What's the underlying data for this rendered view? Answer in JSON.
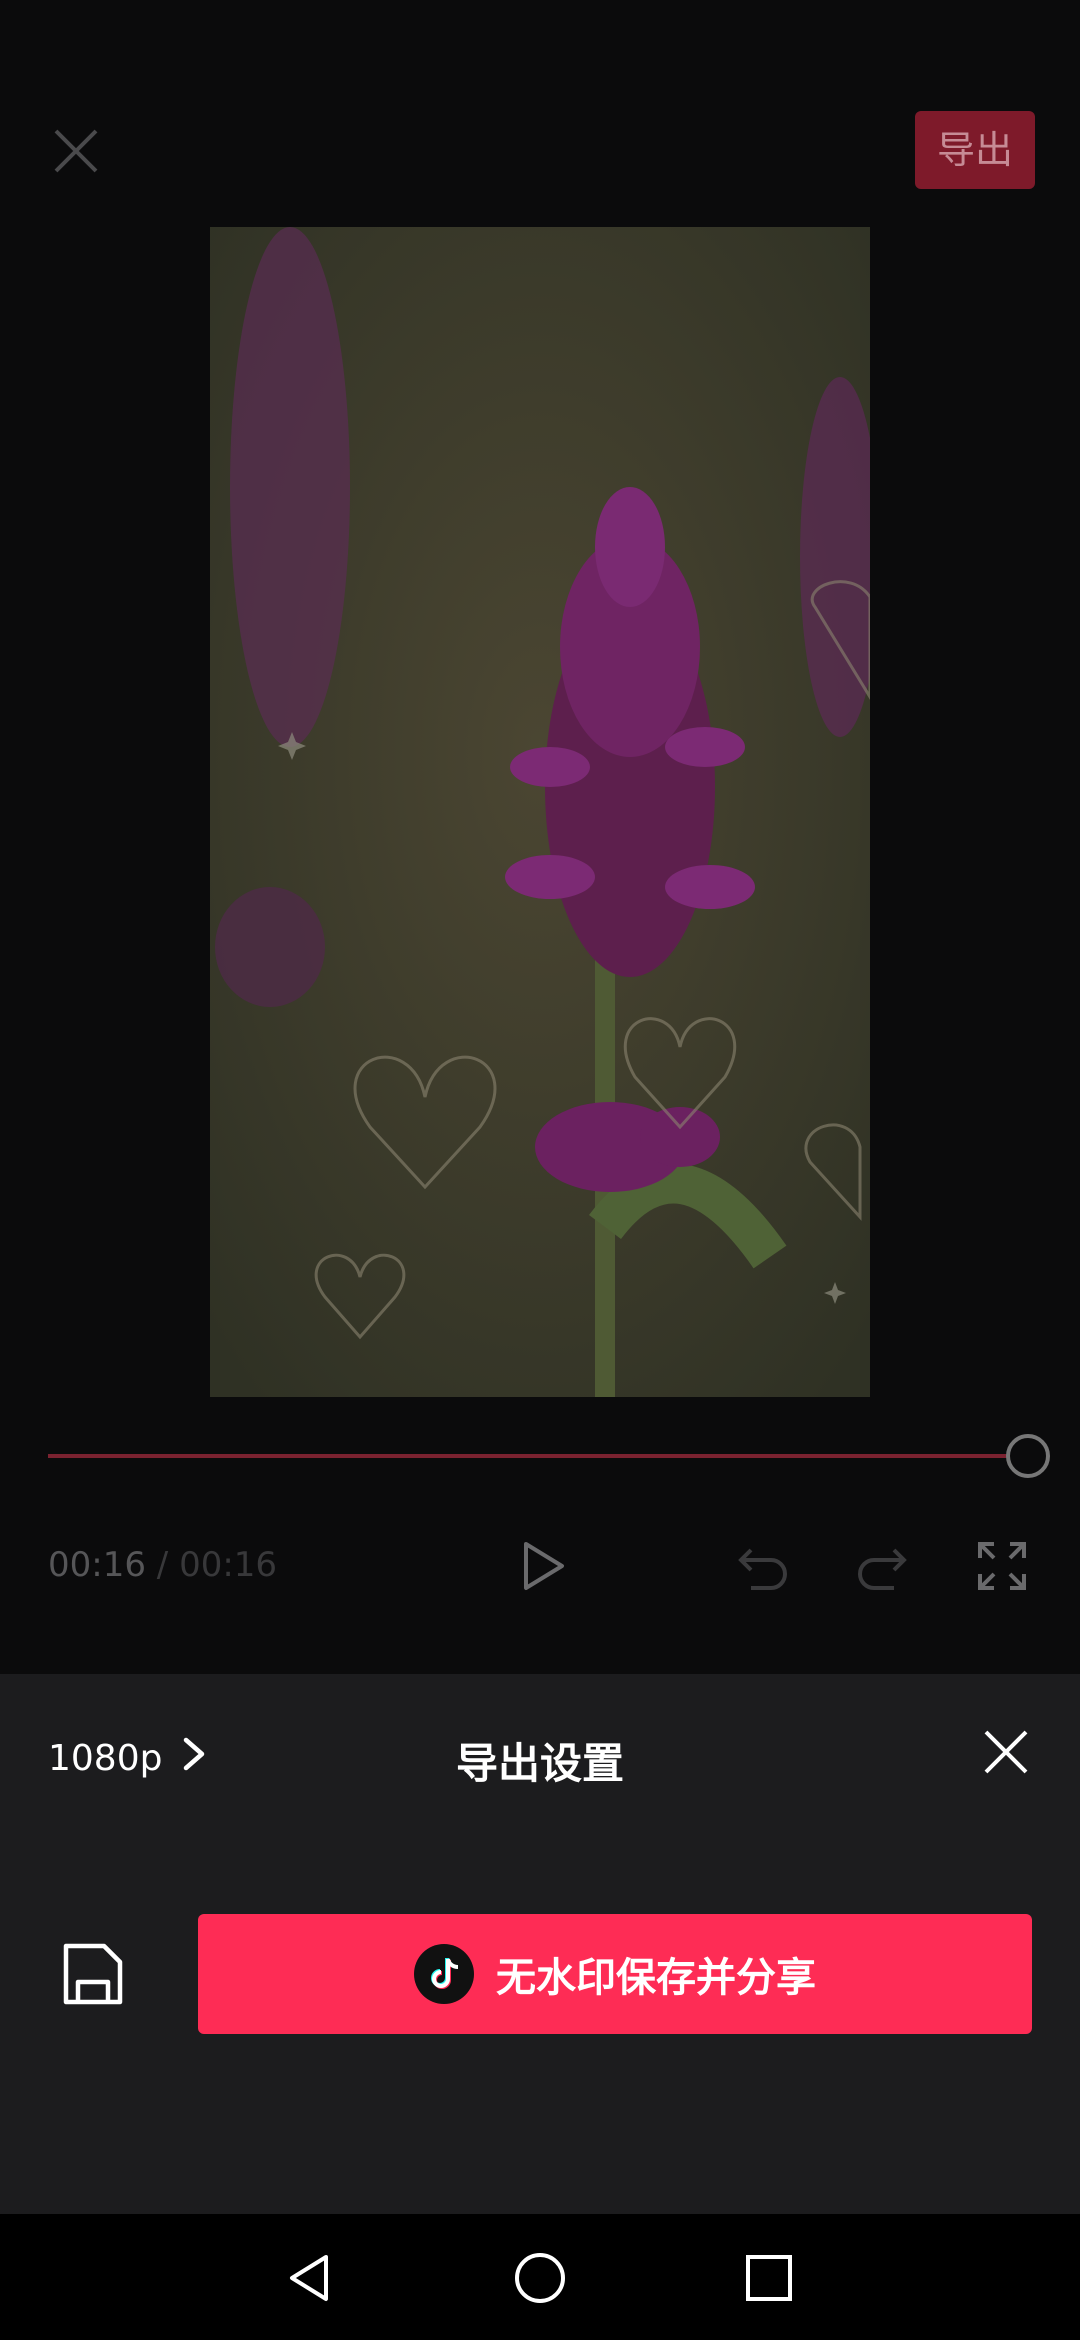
{
  "header": {
    "export_label": "导出"
  },
  "player": {
    "current_time": "00:16",
    "separator": " / ",
    "total_time": "00:16",
    "progress_fraction": 1.0
  },
  "sheet": {
    "resolution": "1080p",
    "title": "导出设置",
    "share_label": "无水印保存并分享"
  },
  "colors": {
    "accent": "#fe2c55",
    "sheet_bg": "#1c1c1e",
    "page_bg": "#0b0b0c"
  },
  "icons": {
    "top_close": "close-icon",
    "play": "play-icon",
    "undo": "undo-icon",
    "redo": "redo-icon",
    "fullscreen": "fullscreen-icon",
    "resolution_chevron": "chevron-right-icon",
    "sheet_close": "close-icon",
    "save": "save-file-icon",
    "tiktok": "tiktok-icon",
    "nav_back": "back-triangle-icon",
    "nav_home": "home-circle-icon",
    "nav_recents": "recents-square-icon"
  }
}
